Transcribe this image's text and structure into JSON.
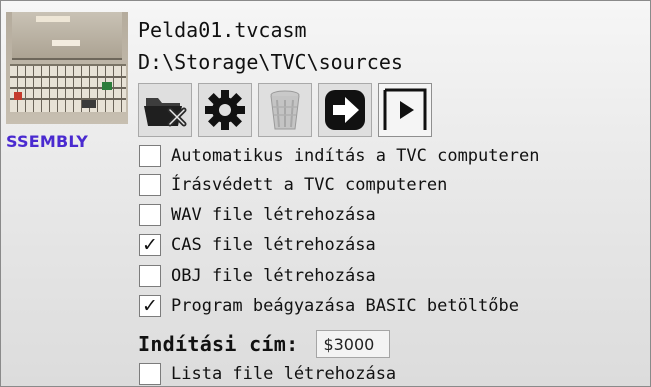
{
  "header": {
    "file_name": "Pelda01.tvcasm",
    "path": "D:\\Storage\\TVC\\sources",
    "mode_badge": "SSEMBLY"
  },
  "toolbar": {
    "buttons": [
      {
        "icon": "remove-file-icon"
      },
      {
        "icon": "gear-icon"
      },
      {
        "icon": "trash-icon",
        "disabled": true
      },
      {
        "icon": "arrow-right-icon"
      },
      {
        "icon": "play-icon"
      }
    ]
  },
  "options": [
    {
      "label": "Automatikus indítás a TVC computeren",
      "checked": false
    },
    {
      "label": "Írásvédett a TVC computeren",
      "checked": false
    },
    {
      "label": "WAV file létrehozása",
      "checked": false
    },
    {
      "label": "CAS file létrehozása",
      "checked": true
    },
    {
      "label": "OBJ file létrehozása",
      "checked": false
    },
    {
      "label": "Program beágyazása BASIC betöltőbe",
      "checked": true
    }
  ],
  "start_address": {
    "label": "Indítási cím:",
    "value": "$3000"
  },
  "list_option": {
    "label": "Lista file létrehozása",
    "checked": false
  },
  "check_glyph": "✓"
}
